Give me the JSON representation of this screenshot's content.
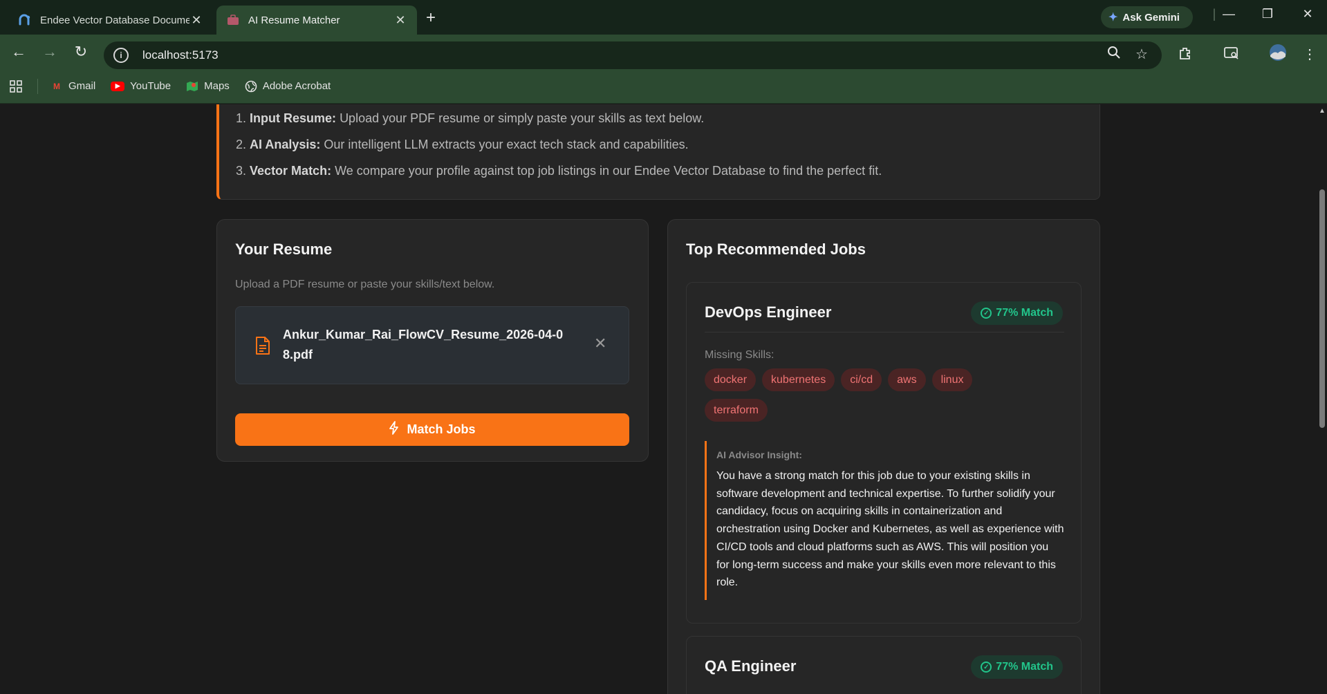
{
  "browser": {
    "tabs": [
      {
        "title": "Endee Vector Database Documentation",
        "active": false
      },
      {
        "title": "AI Resume Matcher",
        "active": true
      }
    ],
    "new_tab": "+",
    "ask_gemini": "Ask Gemini",
    "url": "localhost:5173",
    "bookmarks": [
      {
        "label": "Gmail",
        "icon": "gmail-icon"
      },
      {
        "label": "YouTube",
        "icon": "youtube-icon"
      },
      {
        "label": "Maps",
        "icon": "maps-icon"
      },
      {
        "label": "Adobe Acrobat",
        "icon": "globe-icon"
      }
    ]
  },
  "how_it_works": {
    "steps": [
      {
        "num": "1.",
        "title": "Input Resume:",
        "text": "Upload your PDF resume or simply paste your skills as text below."
      },
      {
        "num": "2.",
        "title": "AI Analysis:",
        "text": "Our intelligent LLM extracts your exact tech stack and capabilities."
      },
      {
        "num": "3.",
        "title": "Vector Match:",
        "text": "We compare your profile against top job listings in our Endee Vector Database to find the perfect fit."
      }
    ]
  },
  "resume": {
    "title": "Your Resume",
    "subtitle": "Upload a PDF resume or paste your skills/text below.",
    "file_name": "Ankur_Kumar_Rai_FlowCV_Resume_2026-04-08.pdf",
    "match_button": "Match Jobs"
  },
  "jobs": {
    "title": "Top Recommended Jobs",
    "missing_label": "Missing Skills:",
    "insight_label": "AI Advisor Insight:",
    "items": [
      {
        "title": "DevOps Engineer",
        "match": "77% Match",
        "missing_skills": [
          "docker",
          "kubernetes",
          "ci/cd",
          "aws",
          "linux",
          "terraform"
        ],
        "insight": "You have a strong match for this job due to your existing skills in software development and technical expertise. To further solidify your candidacy, focus on acquiring skills in containerization and orchestration using Docker and Kubernetes, as well as experience with CI/CD tools and cloud platforms such as AWS. This will position you for long-term success and make your skills even more relevant to this role."
      },
      {
        "title": "QA Engineer",
        "match": "77% Match"
      }
    ]
  },
  "colors": {
    "accent": "#f97316",
    "match_green": "#22c58b",
    "skill_red": "#f07474",
    "chrome_green": "#2c4a31"
  }
}
